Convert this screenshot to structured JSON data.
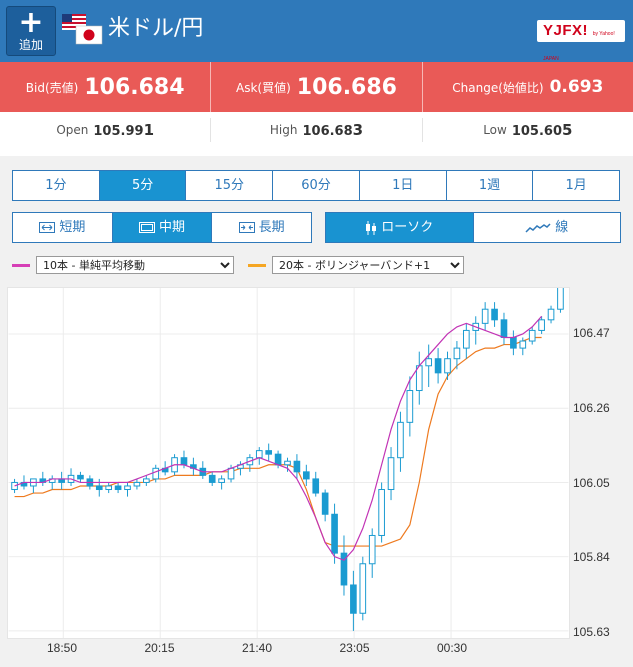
{
  "header": {
    "add_button_label": "追加",
    "pair_title": "米ドル/円",
    "logo_text": "YJFX!",
    "logo_sub": "by Yahoo! JAPAN"
  },
  "quote": {
    "bid_label": "Bid(売値)",
    "bid_main": "106.68",
    "bid_last": "4",
    "ask_label": "Ask(買値)",
    "ask_main": "106.68",
    "ask_last": "6",
    "change_label": "Change(始値比)",
    "change_value": "0.693"
  },
  "stats": {
    "open_label": "Open",
    "open_main": "105.99",
    "open_last": "1",
    "high_label": "High",
    "high_main": "106.68",
    "high_last": "3",
    "low_label": "Low",
    "low_main": "105.60",
    "low_last": "5"
  },
  "timeframes": [
    "1分",
    "5分",
    "15分",
    "60分",
    "1日",
    "1週",
    "1月"
  ],
  "timeframe_selected": "5分",
  "ranges": [
    "短期",
    "中期",
    "長期"
  ],
  "range_selected": "中期",
  "chart_types": [
    "ローソク",
    "線"
  ],
  "chart_type_selected": "ローソク",
  "indicators": {
    "ma": {
      "value": "10本 - 単純平均移動",
      "color": "#d63fb6"
    },
    "bb": {
      "value": "20本 - ボリンジャーバンド+1",
      "color": "#f5a623"
    }
  },
  "colors": {
    "header": "#2f79ba",
    "quote_bar": "#e95a57",
    "candle": "#1a9bd1",
    "ma": "#c233b5",
    "bb": "#ee7a1f"
  },
  "chart_data": {
    "type": "candlestick",
    "x_ticks": [
      "18:50",
      "20:15",
      "21:40",
      "23:05",
      "00:30"
    ],
    "y_ticks": [
      106.47,
      106.26,
      106.05,
      105.84,
      105.63
    ],
    "ylim": [
      105.61,
      106.6
    ],
    "candles": [
      [
        106.03,
        106.06,
        106.02,
        106.05
      ],
      [
        106.05,
        106.07,
        106.03,
        106.04
      ],
      [
        106.04,
        106.06,
        106.02,
        106.06
      ],
      [
        106.06,
        106.08,
        106.04,
        106.05
      ],
      [
        106.05,
        106.07,
        106.03,
        106.06
      ],
      [
        106.06,
        106.08,
        106.03,
        106.05
      ],
      [
        106.05,
        106.09,
        106.04,
        106.07
      ],
      [
        106.07,
        106.08,
        106.05,
        106.06
      ],
      [
        106.06,
        106.07,
        106.03,
        106.04
      ],
      [
        106.04,
        106.06,
        106.01,
        106.03
      ],
      [
        106.03,
        106.05,
        106.02,
        106.04
      ],
      [
        106.04,
        106.05,
        106.02,
        106.03
      ],
      [
        106.03,
        106.05,
        106.01,
        106.04
      ],
      [
        106.04,
        106.06,
        106.03,
        106.05
      ],
      [
        106.05,
        106.07,
        106.04,
        106.06
      ],
      [
        106.06,
        106.1,
        106.05,
        106.09
      ],
      [
        106.09,
        106.11,
        106.07,
        106.08
      ],
      [
        106.08,
        106.13,
        106.07,
        106.12
      ],
      [
        106.12,
        106.14,
        106.09,
        106.1
      ],
      [
        106.1,
        106.12,
        106.07,
        106.09
      ],
      [
        106.09,
        106.11,
        106.06,
        106.07
      ],
      [
        106.07,
        106.08,
        106.04,
        106.05
      ],
      [
        106.05,
        106.07,
        106.03,
        106.06
      ],
      [
        106.06,
        106.1,
        106.05,
        106.09
      ],
      [
        106.09,
        106.11,
        106.07,
        106.1
      ],
      [
        106.1,
        106.13,
        106.08,
        106.12
      ],
      [
        106.12,
        106.15,
        106.1,
        106.14
      ],
      [
        106.14,
        106.16,
        106.11,
        106.13
      ],
      [
        106.13,
        106.14,
        106.09,
        106.1
      ],
      [
        106.1,
        106.12,
        106.08,
        106.11
      ],
      [
        106.11,
        106.13,
        106.06,
        106.08
      ],
      [
        106.08,
        106.1,
        106.04,
        106.06
      ],
      [
        106.06,
        106.08,
        106.01,
        106.02
      ],
      [
        106.02,
        106.03,
        105.94,
        105.96
      ],
      [
        105.96,
        105.99,
        105.82,
        105.85
      ],
      [
        105.85,
        105.9,
        105.73,
        105.76
      ],
      [
        105.76,
        105.8,
        105.63,
        105.68
      ],
      [
        105.68,
        105.84,
        105.66,
        105.82
      ],
      [
        105.82,
        105.92,
        105.78,
        105.9
      ],
      [
        105.9,
        106.05,
        105.88,
        106.03
      ],
      [
        106.03,
        106.15,
        106.0,
        106.12
      ],
      [
        106.12,
        106.25,
        106.08,
        106.22
      ],
      [
        106.22,
        106.35,
        106.18,
        106.31
      ],
      [
        106.31,
        106.42,
        106.27,
        106.38
      ],
      [
        106.38,
        106.44,
        106.32,
        106.4
      ],
      [
        106.4,
        106.43,
        106.33,
        106.36
      ],
      [
        106.36,
        106.42,
        106.34,
        106.4
      ],
      [
        106.4,
        106.45,
        106.37,
        106.43
      ],
      [
        106.43,
        106.5,
        106.4,
        106.48
      ],
      [
        106.48,
        106.52,
        106.44,
        106.5
      ],
      [
        106.5,
        106.56,
        106.48,
        106.54
      ],
      [
        106.54,
        106.56,
        106.49,
        106.51
      ],
      [
        106.51,
        106.53,
        106.44,
        106.46
      ],
      [
        106.46,
        106.48,
        106.41,
        106.43
      ],
      [
        106.43,
        106.46,
        106.41,
        106.45
      ],
      [
        106.45,
        106.49,
        106.44,
        106.48
      ],
      [
        106.48,
        106.52,
        106.47,
        106.51
      ],
      [
        106.51,
        106.55,
        106.5,
        106.54
      ],
      [
        106.54,
        106.62,
        106.53,
        106.61
      ]
    ],
    "ma": [
      106.04,
      106.05,
      106.05,
      106.05,
      106.06,
      106.06,
      106.06,
      106.05,
      106.05,
      106.05,
      106.05,
      106.05,
      106.05,
      106.06,
      106.07,
      106.08,
      106.09,
      106.1,
      106.1,
      106.09,
      106.08,
      106.08,
      106.08,
      106.09,
      106.1,
      106.11,
      106.12,
      106.11,
      106.1,
      106.09,
      106.06,
      106.01,
      105.95,
      105.88,
      105.84,
      105.83,
      105.86,
      105.92,
      106.0,
      106.1,
      106.2,
      106.28,
      106.34,
      106.38,
      106.41,
      106.44,
      106.47,
      106.49,
      106.5,
      106.49,
      106.48,
      106.47,
      106.46,
      106.46,
      106.47,
      106.49,
      106.52
    ],
    "bb": [
      106.01,
      106.01,
      106.02,
      106.02,
      106.03,
      106.03,
      106.03,
      106.04,
      106.04,
      106.04,
      106.04,
      106.05,
      106.05,
      106.05,
      106.05,
      106.06,
      106.06,
      106.07,
      106.07,
      106.07,
      106.07,
      106.08,
      106.08,
      106.08,
      106.09,
      106.09,
      106.09,
      106.1,
      106.1,
      106.1,
      106.09,
      106.03,
      105.95,
      105.88,
      105.87,
      105.87,
      105.87,
      105.87,
      105.87,
      105.87,
      105.88,
      105.89,
      105.93,
      106.05,
      106.2,
      106.3,
      106.35,
      106.38,
      106.4,
      106.42,
      106.43,
      106.43,
      106.44,
      106.44,
      106.45,
      106.46,
      106.46
    ]
  }
}
